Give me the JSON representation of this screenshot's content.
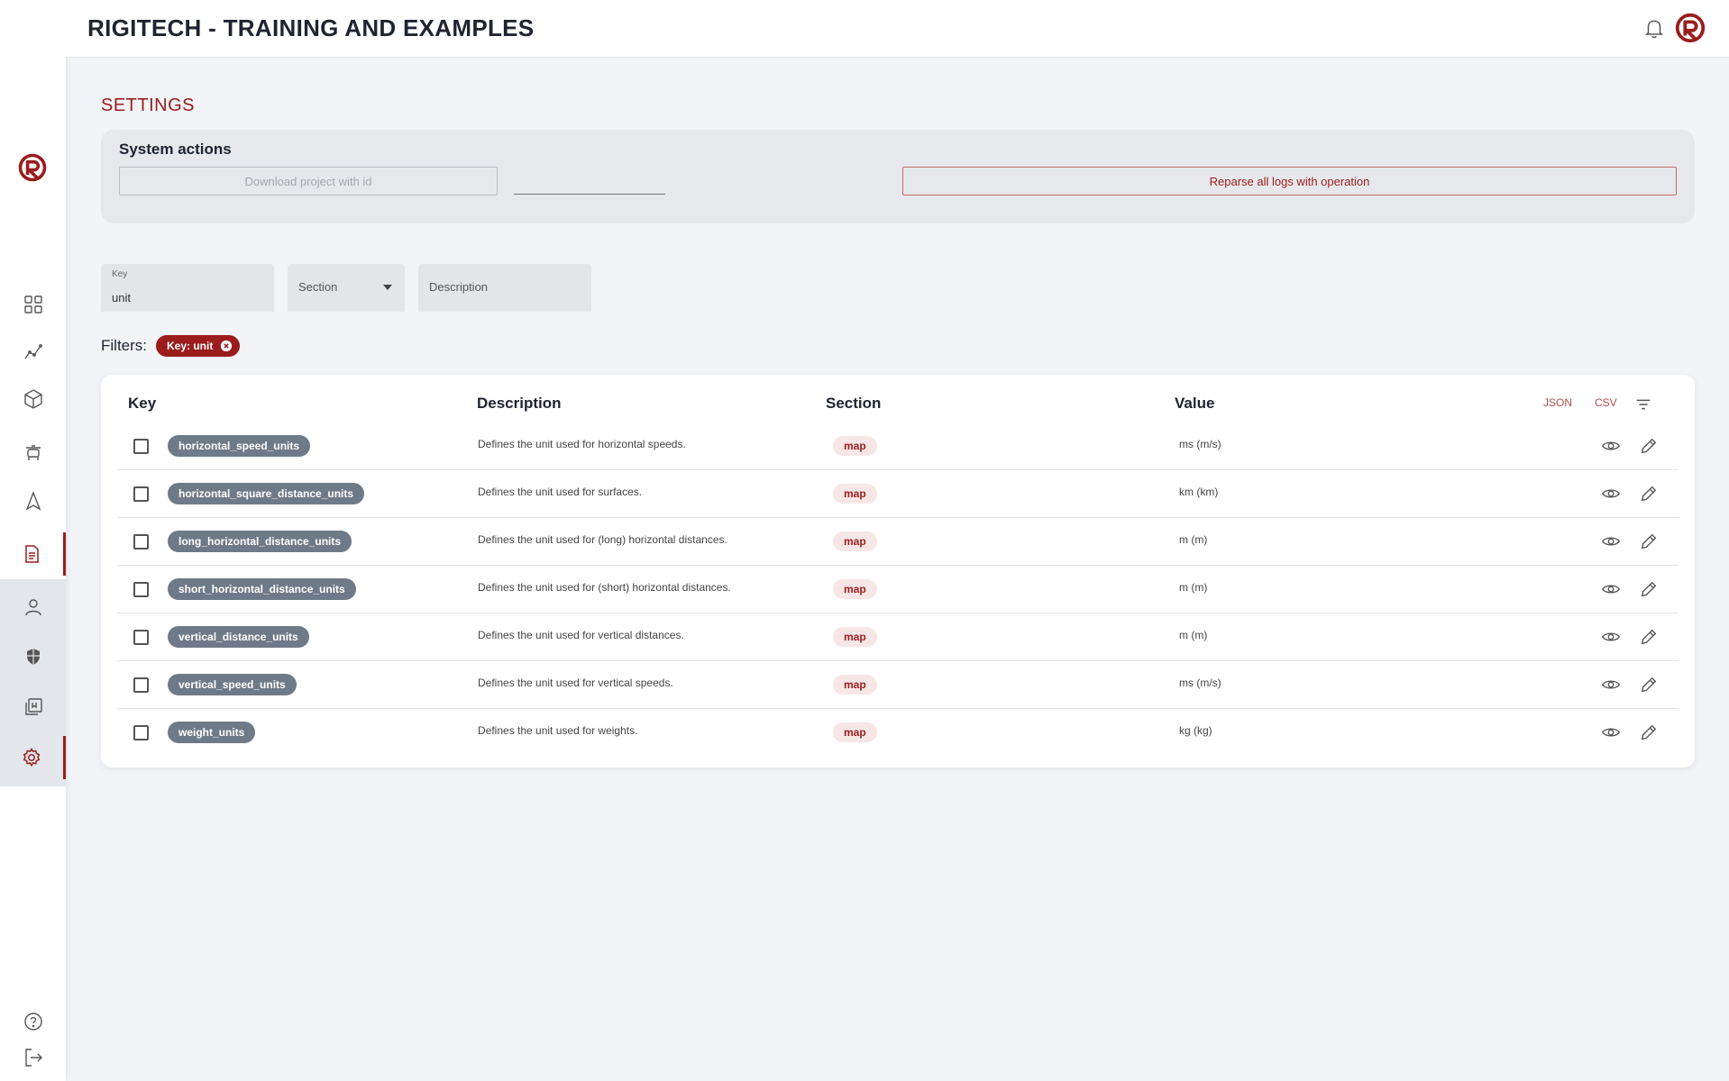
{
  "app": {
    "title": "RIGITECH - TRAINING AND EXAMPLES"
  },
  "header": {
    "icons": [
      "bell-icon",
      "rigitech-logo"
    ]
  },
  "sidebar": {
    "items": [
      {
        "name": "dashboard",
        "icon": "grid-icon"
      },
      {
        "name": "analytics",
        "icon": "chart-line-icon"
      },
      {
        "name": "products",
        "icon": "cube-icon"
      },
      {
        "name": "drones",
        "icon": "drone-icon"
      },
      {
        "name": "navigation",
        "icon": "navigation-icon"
      },
      {
        "name": "logs",
        "icon": "document-icon",
        "active": true
      },
      {
        "name": "users",
        "icon": "user-icon"
      },
      {
        "name": "security",
        "icon": "shield-icon"
      },
      {
        "name": "library",
        "icon": "library-icon"
      },
      {
        "name": "settings",
        "icon": "gear-icon",
        "active": true
      }
    ],
    "bottom": [
      {
        "name": "help",
        "icon": "help-icon"
      },
      {
        "name": "logout",
        "icon": "logout-icon"
      }
    ]
  },
  "page": {
    "title": "SETTINGS"
  },
  "system_actions": {
    "title": "System actions",
    "download_label": "Download project with id",
    "project_id_value": "",
    "reparse_label": "Reparse all logs with operation"
  },
  "search": {
    "key_label": "Key",
    "key_value": "unit",
    "section_label": "Section",
    "description_label": "Description"
  },
  "filters": {
    "label": "Filters:",
    "chips": [
      "Key: unit"
    ]
  },
  "table": {
    "columns": [
      "Key",
      "Description",
      "Section",
      "Value"
    ],
    "export": {
      "json": "JSON",
      "csv": "CSV"
    },
    "rows": [
      {
        "key": "horizontal_speed_units",
        "description": "Defines the unit used for horizontal speeds.",
        "section": "map",
        "value": "ms (m/s)"
      },
      {
        "key": "horizontal_square_distance_units",
        "description": "Defines the unit used for surfaces.",
        "section": "map",
        "value": "km (km)"
      },
      {
        "key": "long_horizontal_distance_units",
        "description": "Defines the unit used for (long) horizontal distances.",
        "section": "map",
        "value": "m (m)"
      },
      {
        "key": "short_horizontal_distance_units",
        "description": "Defines the unit used for (short) horizontal distances.",
        "section": "map",
        "value": "m (m)"
      },
      {
        "key": "vertical_distance_units",
        "description": "Defines the unit used for vertical distances.",
        "section": "map",
        "value": "m (m)"
      },
      {
        "key": "vertical_speed_units",
        "description": "Defines the unit used for vertical speeds.",
        "section": "map",
        "value": "ms (m/s)"
      },
      {
        "key": "weight_units",
        "description": "Defines the unit used for weights.",
        "section": "map",
        "value": "kg (kg)"
      }
    ]
  },
  "colors": {
    "brand": "#9b1c1c",
    "pill_gray": "#6f7a88",
    "page_bg": "#f2f4f7"
  }
}
